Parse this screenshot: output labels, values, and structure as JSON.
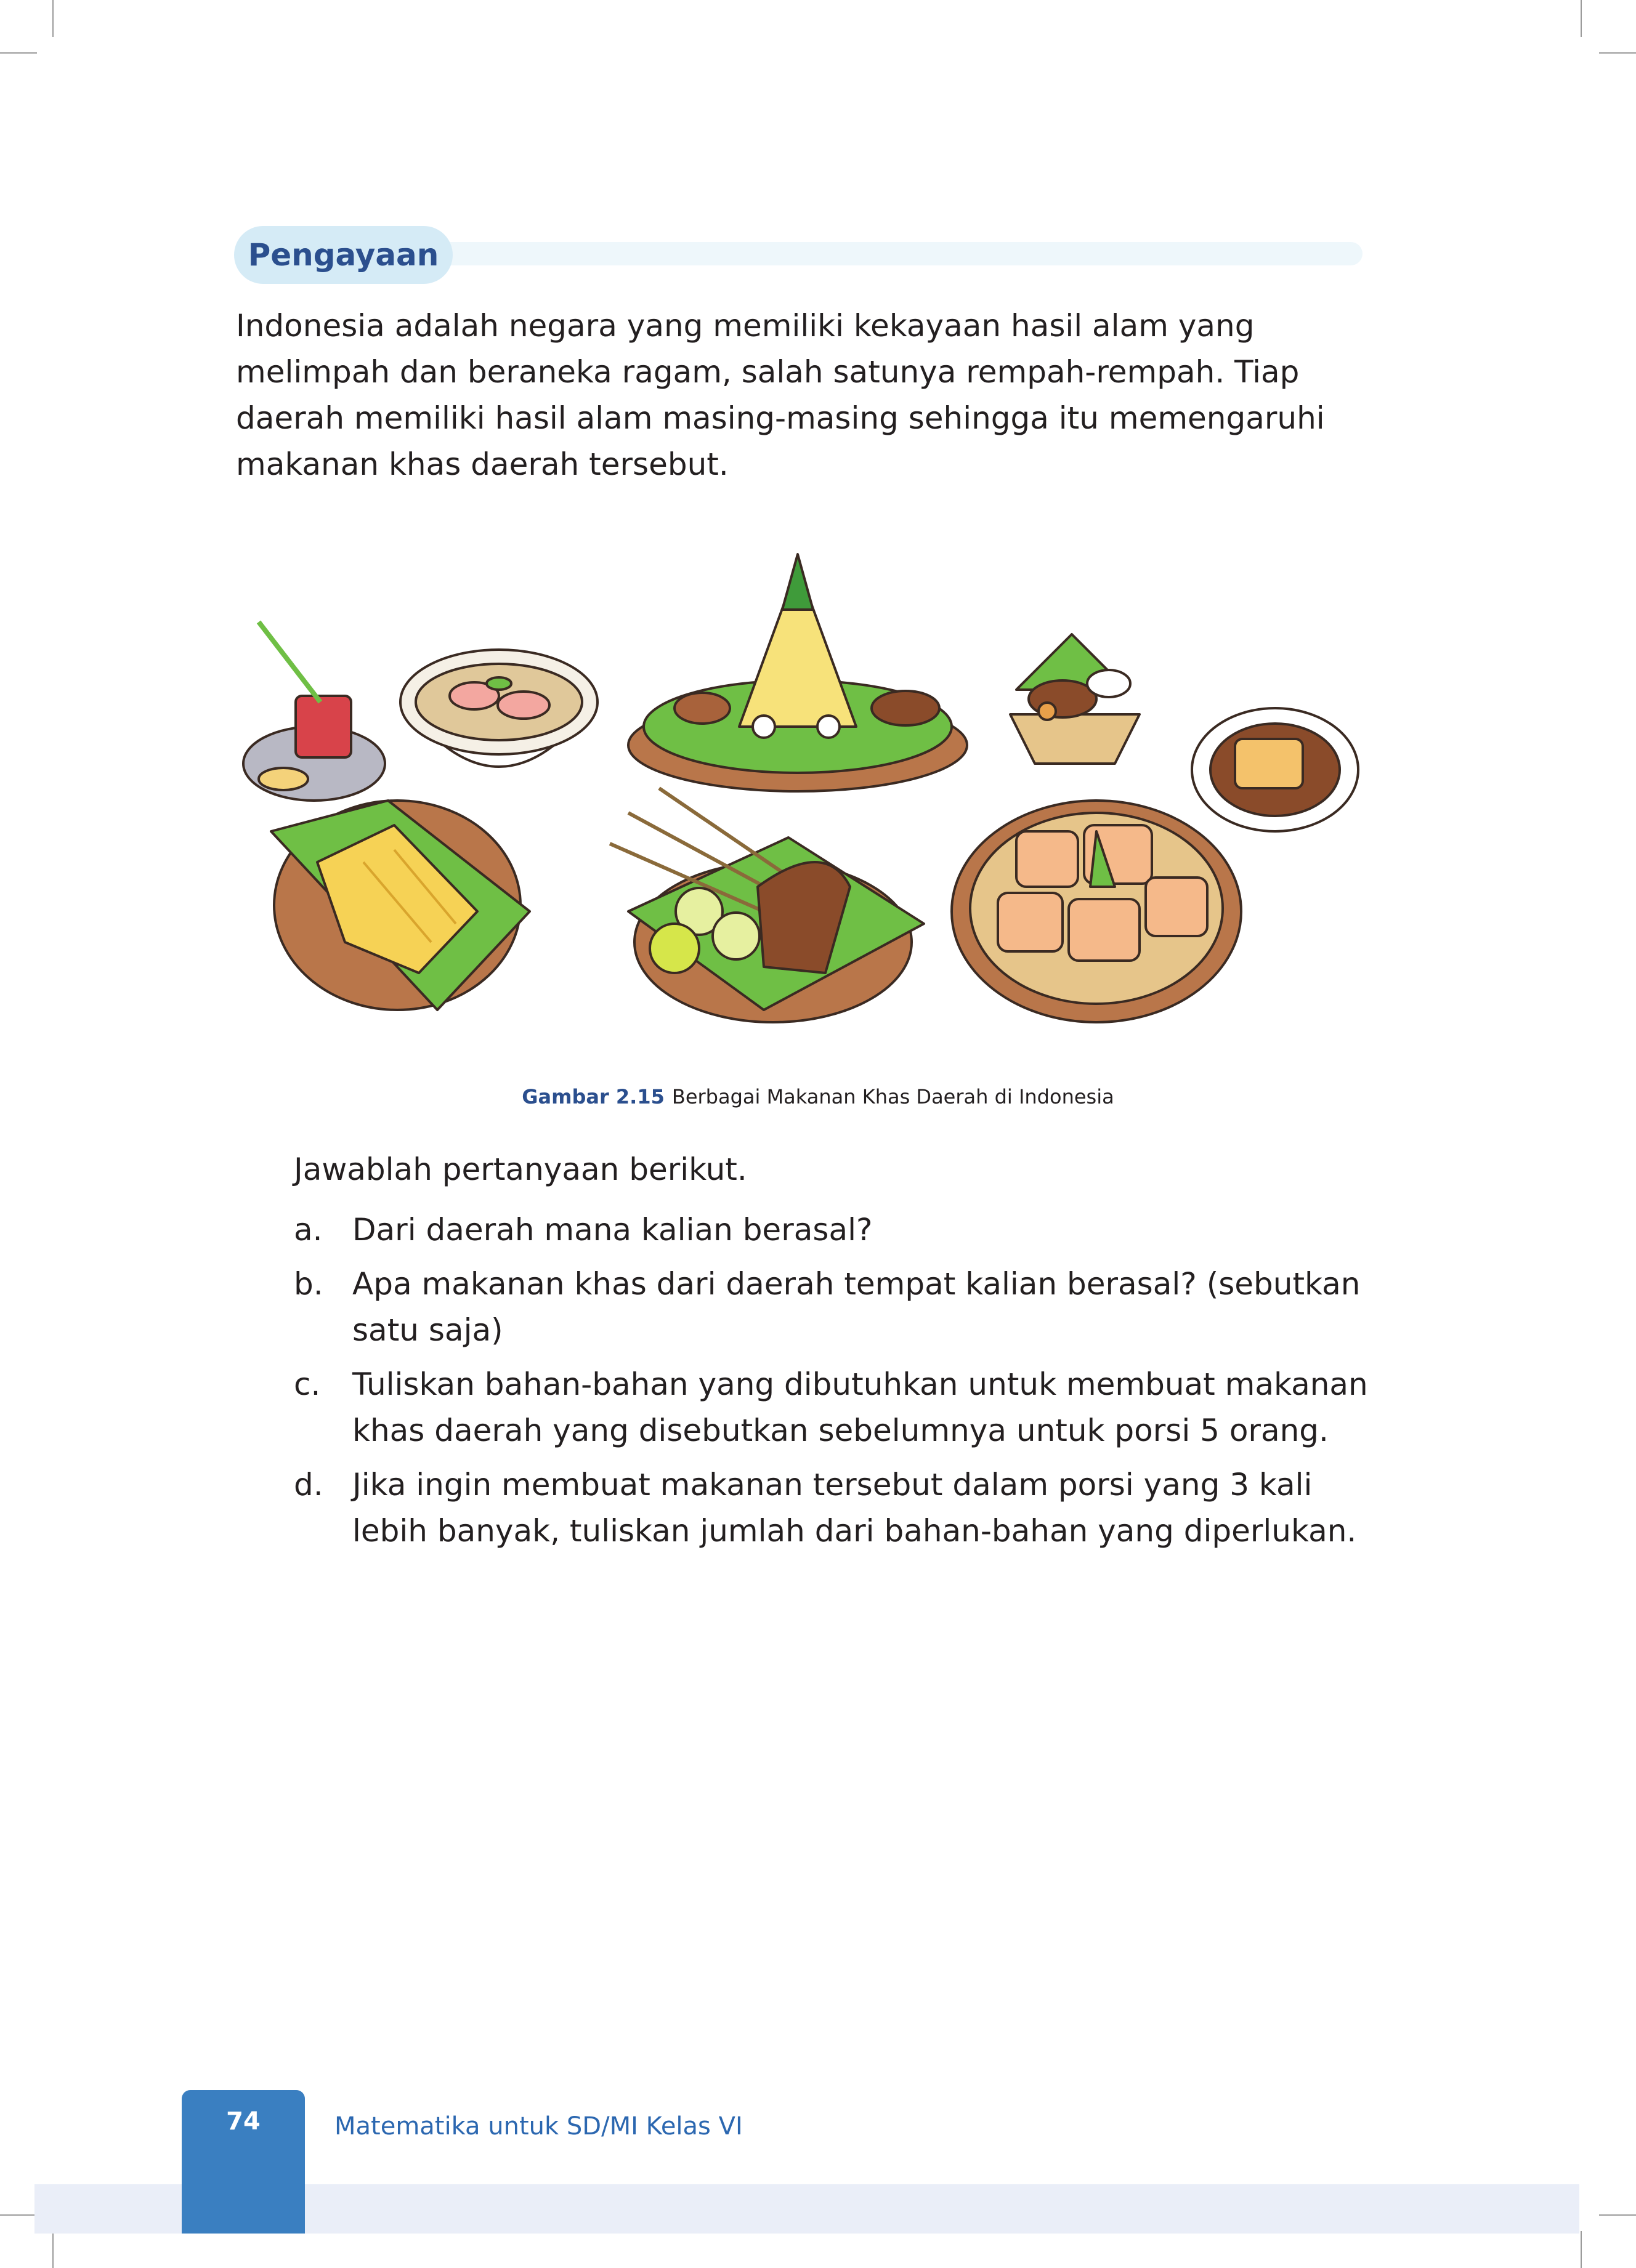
{
  "section": {
    "label": "Pengayaan"
  },
  "intro": {
    "text": "Indonesia adalah negara yang memiliki kekayaan hasil alam yang melimpah dan beraneka ragam, salah satunya rempah-rempah. Tiap daerah memiliki hasil alam masing-masing sehingga itu memengaruhi makanan khas daerah tersebut."
  },
  "figure": {
    "number": "Gambar 2.15",
    "caption": "Berbagai Makanan Khas Daerah di Indonesia",
    "colors": {
      "leaf": "#6fbf45",
      "plate": "#b9764a",
      "outline": "#3a2a22",
      "food": "#f4c26b"
    }
  },
  "questions": {
    "prompt": "Jawablah pertanyaan berikut.",
    "items": [
      {
        "marker": "a.",
        "text": "Dari daerah mana kalian berasal?"
      },
      {
        "marker": "b.",
        "text": "Apa makanan khas dari daerah tempat kalian berasal? (sebutkan satu saja)"
      },
      {
        "marker": "c.",
        "text": "Tuliskan bahan-bahan yang dibutuhkan untuk membuat makanan khas daerah yang disebutkan sebelumnya untuk porsi 5 orang."
      },
      {
        "marker": "d.",
        "text": "Jika ingin membuat makanan tersebut dalam porsi yang 3 kali lebih banyak, tuliskan jumlah dari bahan-bahan yang diperlukan."
      }
    ]
  },
  "footer": {
    "page_number": "74",
    "book_title": "Matematika untuk SD/MI Kelas VI",
    "colors": {
      "tab": "#3a7fc1",
      "title": "#2b67b0",
      "band": "#eaeef8"
    }
  }
}
